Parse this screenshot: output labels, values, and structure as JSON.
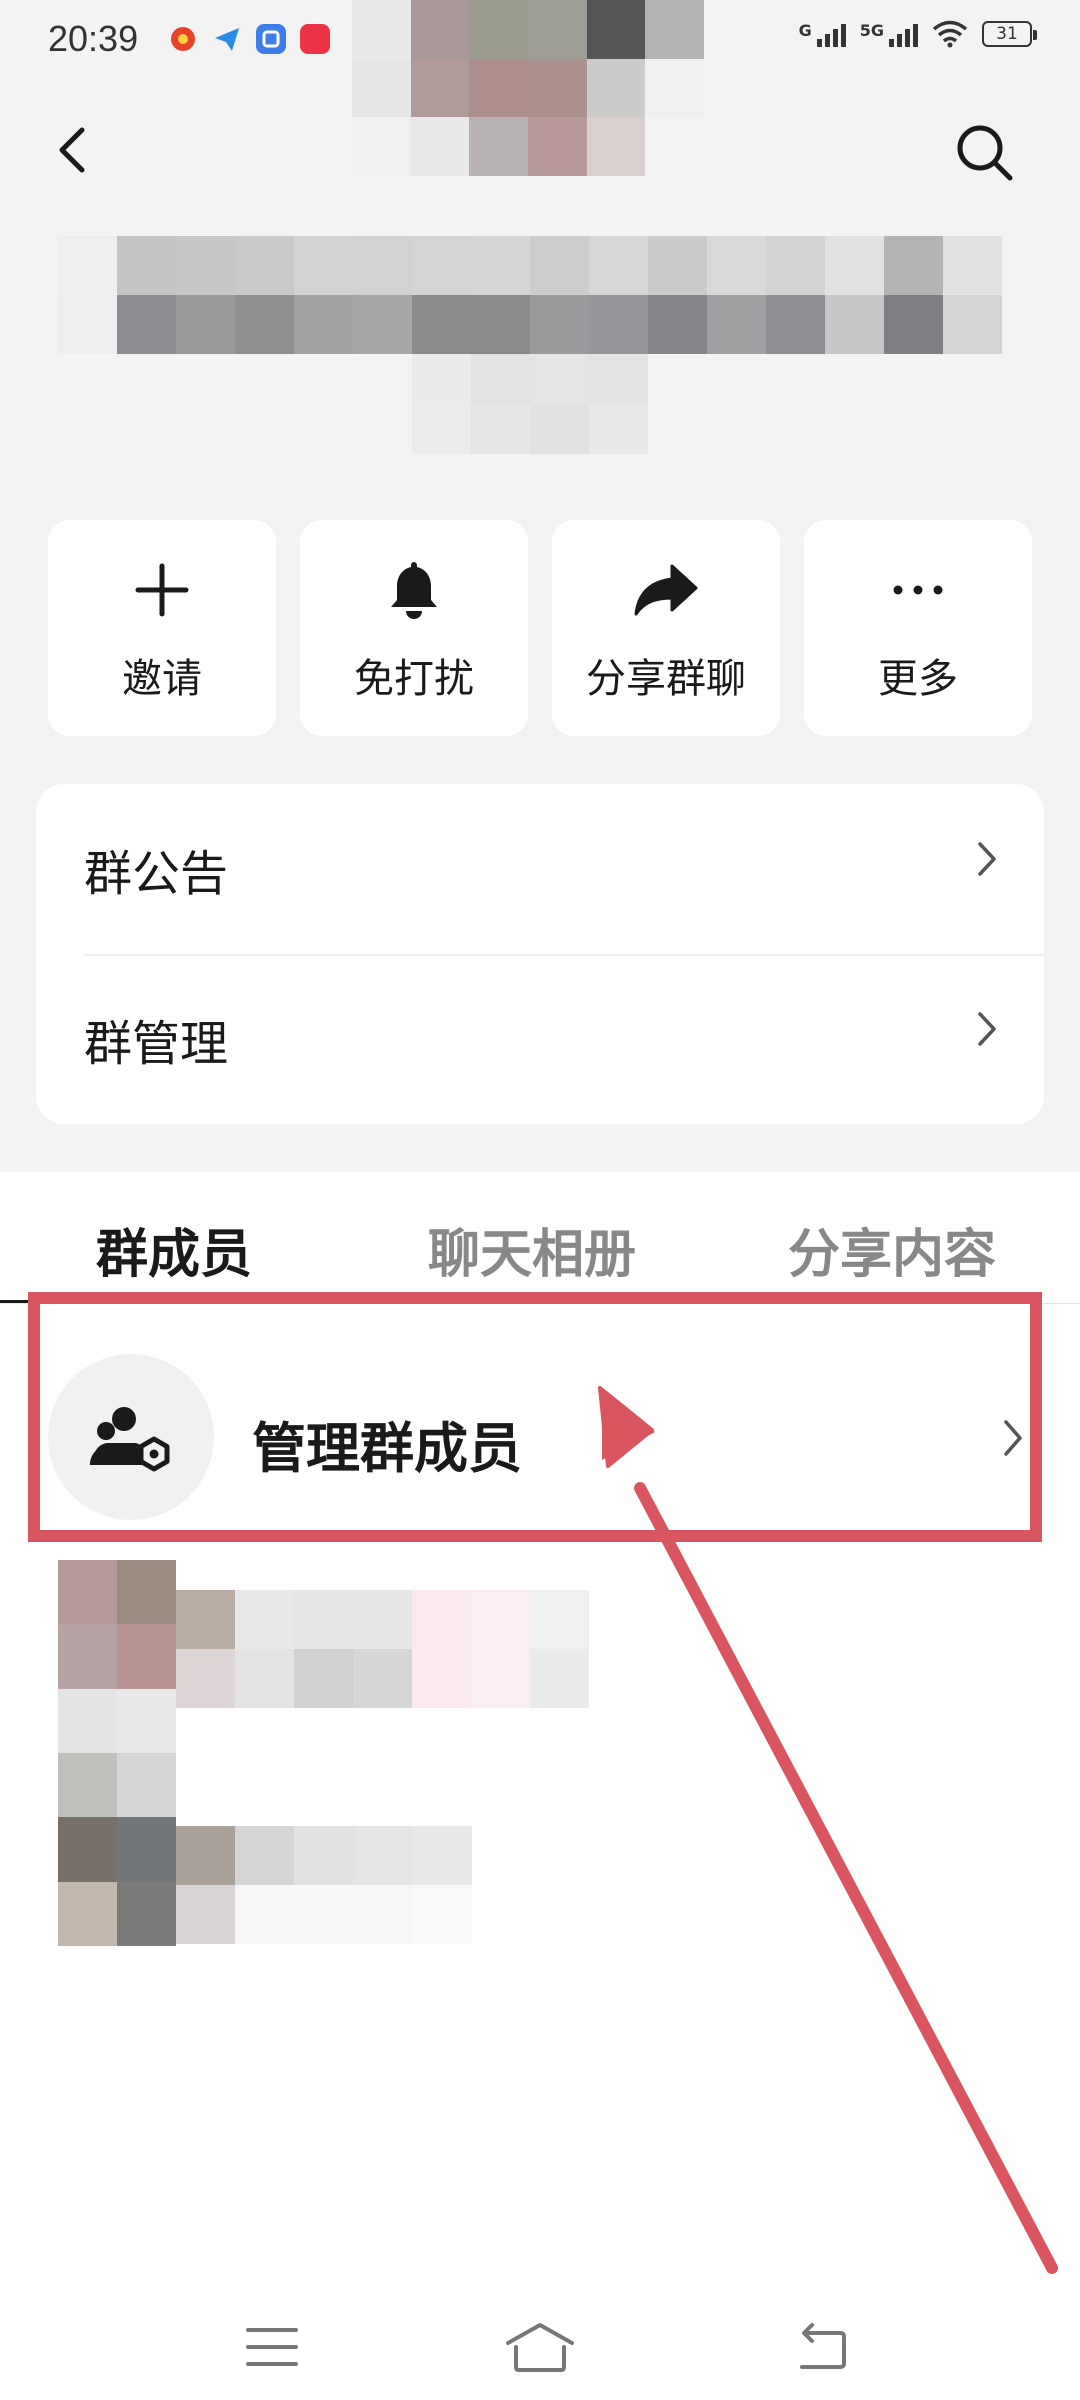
{
  "status_bar": {
    "time": "20:39",
    "signal_1_label": "G",
    "signal_2_label": "5G",
    "battery": "31"
  },
  "actions": [
    {
      "label": "邀请",
      "icon": "plus-icon"
    },
    {
      "label": "免打扰",
      "icon": "bell-icon"
    },
    {
      "label": "分享群聊",
      "icon": "share-arrow-icon"
    },
    {
      "label": "更多",
      "icon": "more-dots-icon"
    }
  ],
  "settings": {
    "announcement": "群公告",
    "management": "群管理"
  },
  "tabs": [
    {
      "label": "群成员",
      "active": true
    },
    {
      "label": "聊天相册",
      "active": false
    },
    {
      "label": "分享内容",
      "active": false
    }
  ],
  "members": {
    "manage_label": "管理群成员",
    "manage_icon": "manage-members-icon"
  },
  "annotation": {
    "color": "#d9555f"
  },
  "colors": {
    "page_bg": "#f3f3f3",
    "card_bg": "#ffffff",
    "text_primary": "#1a1a1a",
    "text_secondary": "#888888",
    "annotation_red": "#d9555f"
  }
}
